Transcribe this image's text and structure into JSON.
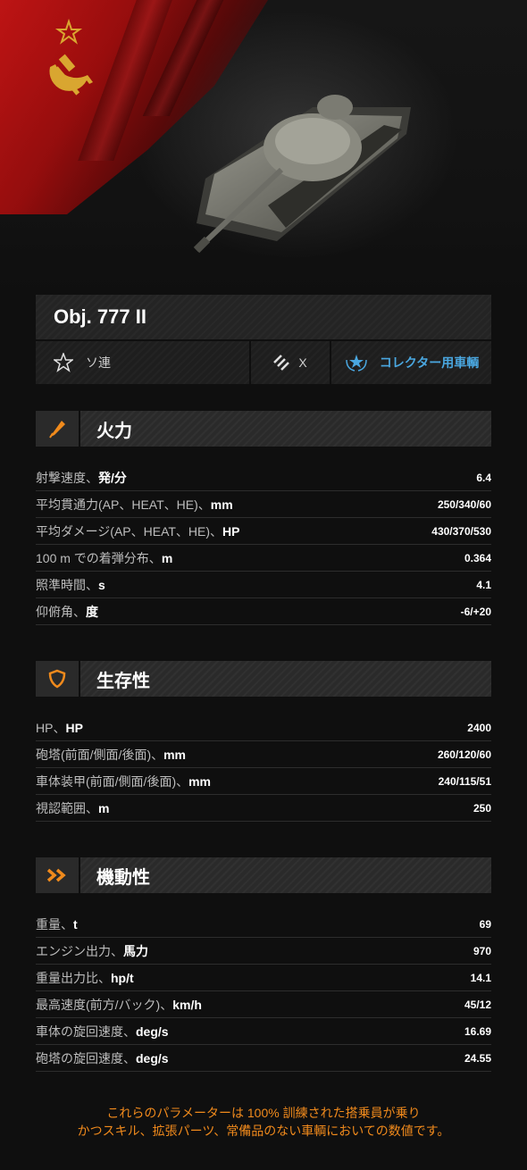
{
  "tank": {
    "name": "Obj. 777 II",
    "nation": "ソ連",
    "tier": "X",
    "type": "コレクター用車輌"
  },
  "sections": [
    {
      "title": "火力",
      "icon": "firepower-icon",
      "rows": [
        {
          "label": "射撃速度、",
          "unit": "発/分",
          "value": "6.4"
        },
        {
          "label": "平均貫通力(AP、HEAT、HE)、",
          "unit": "mm",
          "value": "250/340/60"
        },
        {
          "label": "平均ダメージ(AP、HEAT、HE)、",
          "unit": "HP",
          "value": "430/370/530"
        },
        {
          "label": "100 m での着弾分布、",
          "unit": "m",
          "value": "0.364"
        },
        {
          "label": "照準時間、",
          "unit": "s",
          "value": "4.1"
        },
        {
          "label": "仰俯角、",
          "unit": "度",
          "value": "-6/+20"
        }
      ]
    },
    {
      "title": "生存性",
      "icon": "shield-icon",
      "rows": [
        {
          "label": "HP、",
          "unit": "HP",
          "value": "2400"
        },
        {
          "label": "砲塔(前面/側面/後面)、",
          "unit": "mm",
          "value": "260/120/60"
        },
        {
          "label": "車体装甲(前面/側面/後面)、",
          "unit": "mm",
          "value": "240/115/51"
        },
        {
          "label": "視認範囲、",
          "unit": "m",
          "value": "250"
        }
      ]
    },
    {
      "title": "機動性",
      "icon": "double-chevron-icon",
      "rows": [
        {
          "label": "重量、",
          "unit": "t",
          "value": "69"
        },
        {
          "label": "エンジン出力、",
          "unit": "馬力",
          "value": "970"
        },
        {
          "label": "重量出力比、",
          "unit": "hp/t",
          "value": "14.1"
        },
        {
          "label": "最高速度(前方/バック)、",
          "unit": "km/h",
          "value": "45/12"
        },
        {
          "label": "車体の旋回速度、",
          "unit": "deg/s",
          "value": "16.69"
        },
        {
          "label": "砲塔の旋回速度、",
          "unit": "deg/s",
          "value": "24.55"
        }
      ]
    }
  ],
  "footnote": {
    "line1": "これらのパラメーターは 100% 訓練された搭乗員が乗り",
    "line2": "かつスキル、拡張パーツ、常備品のない車輌においての数値です。"
  },
  "colors": {
    "accent_orange": "#f08a1c",
    "accent_blue": "#4aa7e0",
    "flag_red": "#c41414"
  }
}
